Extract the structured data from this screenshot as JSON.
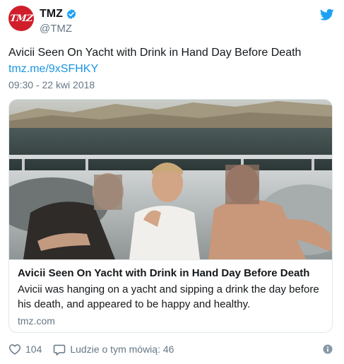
{
  "author": {
    "display_name": "TMZ",
    "handle": "@TMZ",
    "avatar_text": "TMZ"
  },
  "tweet": {
    "text": "Avicii Seen On Yacht with Drink in Hand Day Before Death",
    "link": "tmz.me/9xSFHKY",
    "timestamp": "09:30 - 22 kwi 2018"
  },
  "card": {
    "title": "Avicii Seen On Yacht with Drink in Hand Day Before Death",
    "description": "Avicii was hanging on a yacht and sipping a drink the day before his death, and appeared to be happy and healthy.",
    "domain": "tmz.com"
  },
  "footer": {
    "likes": "104",
    "conversation_label": "Ludzie o tym mówią: 46"
  },
  "icons": {
    "verified": "verified-badge-icon",
    "bird": "twitter-bird-icon",
    "like": "heart-icon",
    "conversation": "speech-bubble-icon",
    "info": "info-icon"
  },
  "colors": {
    "brand_blue": "#1da1f2",
    "link_blue": "#1b95e0",
    "tmz_red": "#d01e2a",
    "muted_text": "#657786",
    "border": "#e1e8ed"
  }
}
